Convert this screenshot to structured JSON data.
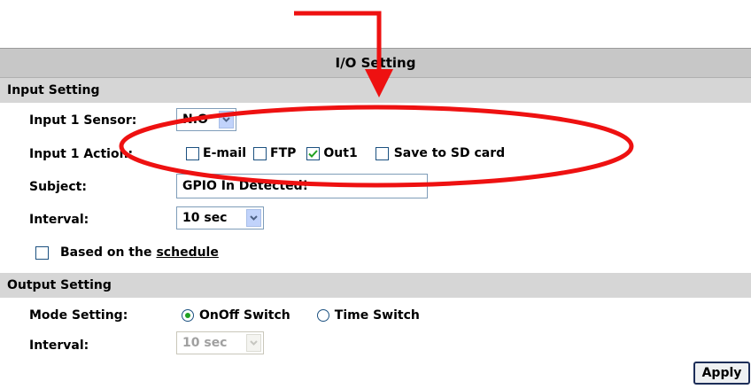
{
  "header": {
    "title": "I/O Setting"
  },
  "input_section": {
    "title": "Input Setting",
    "sensor": {
      "label": "Input 1 Sensor:",
      "value": "N.O"
    },
    "action": {
      "label": "Input 1 Action:",
      "options": [
        {
          "label": "E-mail",
          "checked": false
        },
        {
          "label": "FTP",
          "checked": false
        },
        {
          "label": "Out1",
          "checked": true
        },
        {
          "label": "Save to SD card",
          "checked": false
        }
      ]
    },
    "subject": {
      "label": "Subject:",
      "value": "GPIO In Detected!"
    },
    "interval": {
      "label": "Interval:",
      "value": "10 sec"
    },
    "schedule": {
      "prefix": "Based on the ",
      "link": "schedule",
      "checked": false
    }
  },
  "output_section": {
    "title": "Output Setting",
    "mode": {
      "label": "Mode Setting:",
      "options": [
        {
          "label": "OnOff Switch",
          "selected": true
        },
        {
          "label": "Time Switch",
          "selected": false
        }
      ]
    },
    "interval": {
      "label": "Interval:",
      "value": "10 sec"
    }
  },
  "apply_label": "Apply",
  "annotation": {
    "color": "#ee1111",
    "shapes": [
      "arrow-annotation",
      "ellipse-annotation"
    ]
  }
}
